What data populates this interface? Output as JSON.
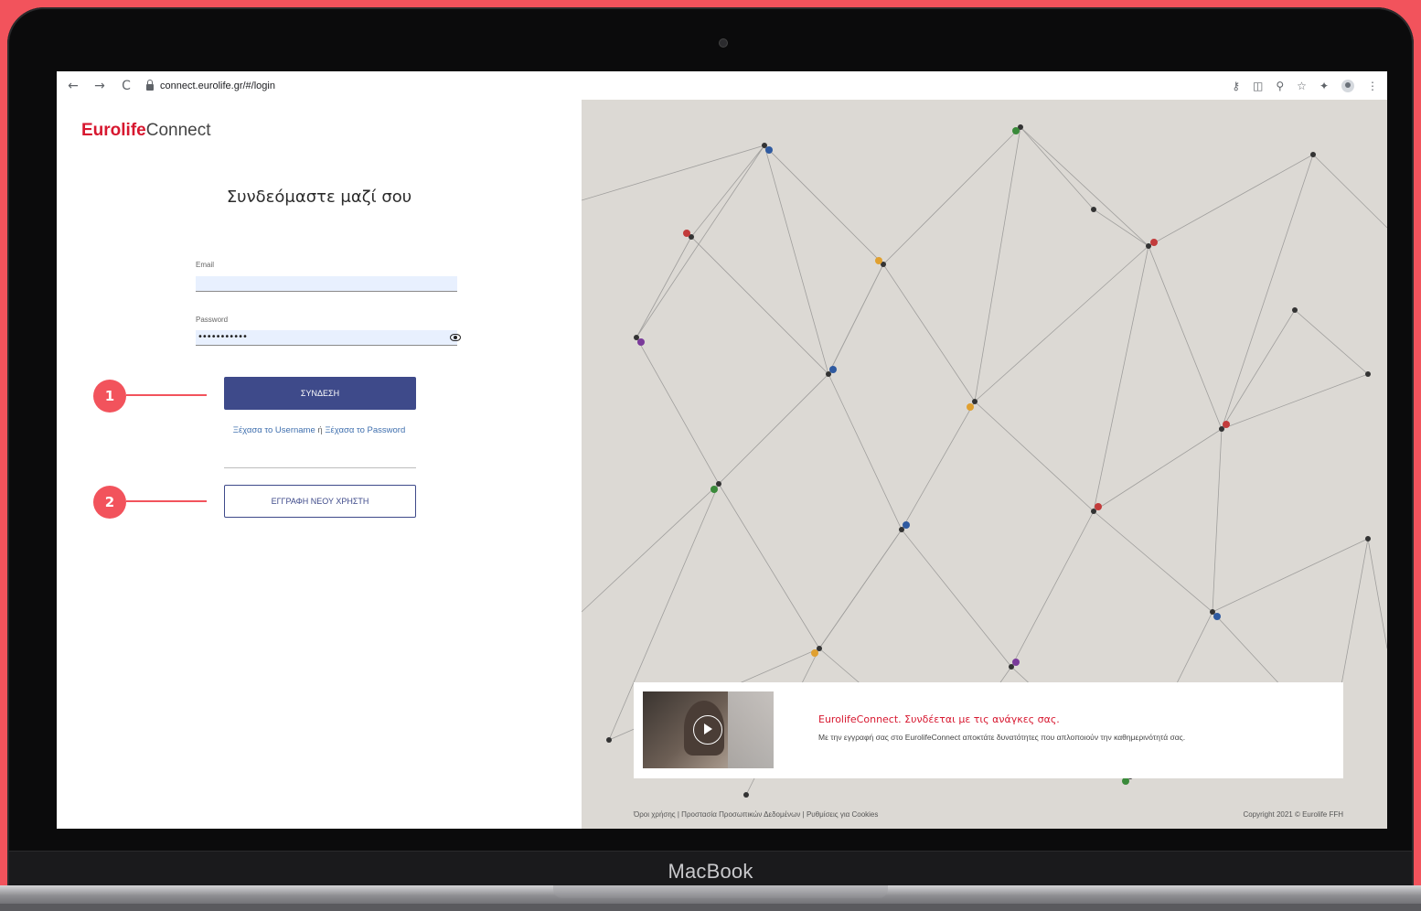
{
  "browser": {
    "url": "connect.eurolife.gr/#/login"
  },
  "logo": {
    "part1": "Eurolife",
    "part2": "Connect"
  },
  "login": {
    "heading": "Συνδεόμαστε μαζί σου",
    "email_label": "Email",
    "password_label": "Password",
    "password_masked": "•••••••••••",
    "submit_label": "ΣΥΝΔΕΣΗ",
    "forgot_username": "Ξέχασα το Username",
    "or": "ή",
    "forgot_password": "Ξέχασα το Password",
    "register_label": "ΕΓΓΡΑΦΗ ΝΕΟΥ ΧΡΗΣΤΗ"
  },
  "promo": {
    "title": "EurolifeConnect. Συνδέεται με τις ανάγκες σας.",
    "text": "Με την εγγραφή σας στο EurolifeConnect αποκτάτε δυνατότητες που απλοποιούν την καθημερινότητά σας."
  },
  "footer": {
    "links": "Όροι χρήσης | Προστασία Προσωπικών Δεδομένων | Ρυθμίσεις για Cookies",
    "copyright": "Copyright 2021 © Eurolife FFH"
  },
  "annotations": {
    "step1": "1",
    "step2": "2"
  },
  "device": {
    "label": "MacBook"
  },
  "colors": {
    "background": "#f2535c",
    "brand_red": "#d7172f",
    "primary_button": "#3e4a8a",
    "link": "#3f6fae"
  }
}
